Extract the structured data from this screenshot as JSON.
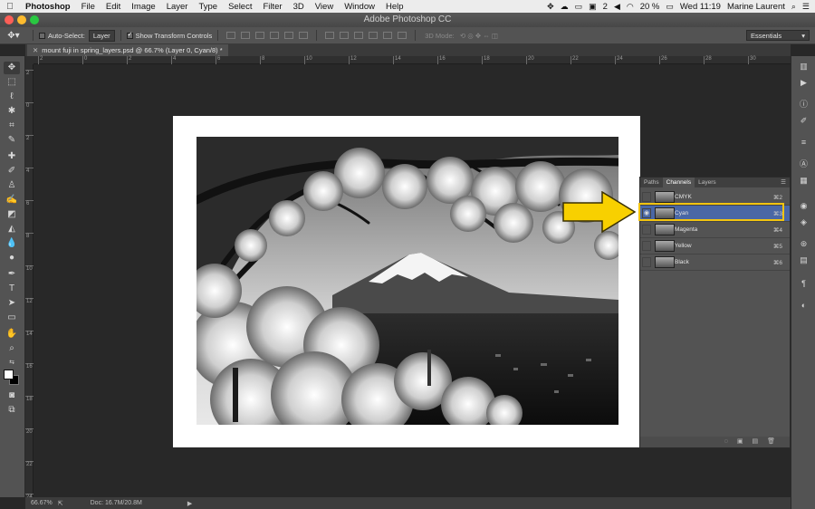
{
  "menubar": {
    "items": [
      "Photoshop",
      "File",
      "Edit",
      "Image",
      "Layer",
      "Type",
      "Select",
      "Filter",
      "3D",
      "View",
      "Window",
      "Help"
    ],
    "battery": "20 %",
    "clock": "Wed 11:19",
    "user": "Marine Laurent",
    "badge_count": "2"
  },
  "title": "Adobe Photoshop CC",
  "options": {
    "auto_select_label": "Auto-Select:",
    "auto_select_value": "Layer",
    "show_transform_label": "Show Transform Controls",
    "mode3d_label": "3D Mode:",
    "workspace": "Essentials"
  },
  "document": {
    "tab_title": "mount fuji in spring_layers.psd @ 66.7% (Layer 0, Cyan/8) *"
  },
  "rulers": {
    "top": [
      "2",
      "0",
      "2",
      "4",
      "6",
      "8",
      "10",
      "12",
      "14",
      "16",
      "18",
      "20",
      "22",
      "24",
      "26",
      "28",
      "30"
    ],
    "left": [
      "2",
      "0",
      "2",
      "4",
      "6",
      "8",
      "10",
      "12",
      "14",
      "16",
      "18",
      "20",
      "22",
      "24"
    ]
  },
  "channels_panel": {
    "tabs": [
      "Paths",
      "Channels",
      "Layers"
    ],
    "active_tab": "Channels",
    "rows": [
      {
        "name": "CMYK",
        "shortcut": "⌘2",
        "visible": false,
        "selected": false
      },
      {
        "name": "Cyan",
        "shortcut": "⌘3",
        "visible": true,
        "selected": true
      },
      {
        "name": "Magenta",
        "shortcut": "⌘4",
        "visible": false,
        "selected": false
      },
      {
        "name": "Yellow",
        "shortcut": "⌘5",
        "visible": false,
        "selected": false
      },
      {
        "name": "Black",
        "shortcut": "⌘6",
        "visible": false,
        "selected": false
      }
    ]
  },
  "status": {
    "zoom": "66.67%",
    "doc": "Doc: 16.7M/20.8M"
  },
  "colors": {
    "highlight": "#f2c410",
    "arrow": "#f8d000",
    "selection": "#4a67a5"
  }
}
